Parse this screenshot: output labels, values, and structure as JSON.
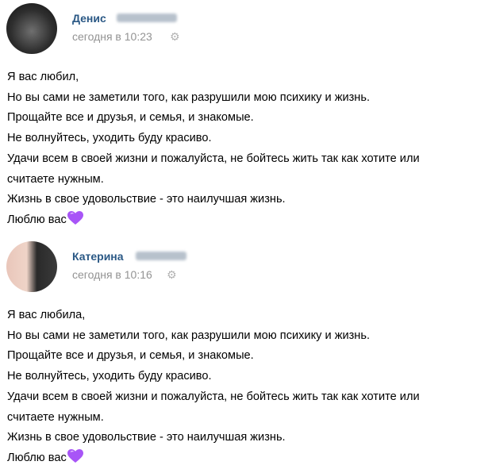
{
  "posts": [
    {
      "author": "Денис",
      "time": "сегодня в 10:23",
      "lines": [
        "Я вас любил,",
        "Но вы сами не заметили того, как разрушили мою психику и жизнь.",
        "Прощайте все и друзья, и семья, и знакомые.",
        "Не волнуйтесь, уходить буду красиво.",
        "Удачи всем в своей жизни и пожалуйста, не бойтесь жить так как хотите или",
        "считаете нужным.",
        "Жизнь в свое удовольствие - это наилучшая жизнь.",
        "Люблю вас"
      ]
    },
    {
      "author": "Катерина",
      "time": "сегодня в 10:16",
      "lines": [
        "Я вас любила,",
        "Но вы сами не заметили того, как разрушили мою психику и жизнь.",
        "Прощайте все и друзья, и семья, и знакомые.",
        "Не волнуйтесь, уходить буду красиво.",
        "Удачи всем в своей жизни и пожалуйста, не бойтесь жить так как хотите или",
        "считаете нужным.",
        "Жизнь в свое удовольствие - это наилучшая жизнь.",
        "Люблю вас"
      ]
    }
  ],
  "icons": {
    "settings": "gear-icon",
    "emoji": "purple-heart-icon"
  },
  "colors": {
    "author_link": "#2a5885",
    "timestamp": "#939393",
    "heart": "#a855f7"
  }
}
